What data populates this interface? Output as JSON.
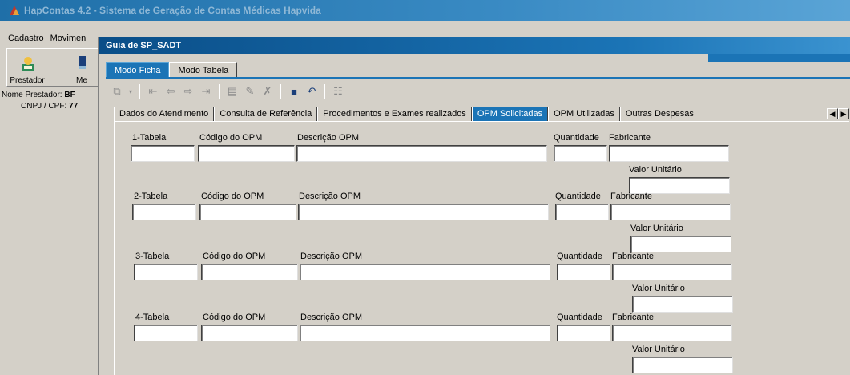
{
  "window": {
    "title": "HapContas 4.2 - Sistema de Geração de Contas Médicas Hapvida"
  },
  "menu": {
    "items": [
      "Cadastro",
      "Movimen"
    ]
  },
  "toolbar": {
    "btn1": "Prestador",
    "btn2": "Me"
  },
  "info": {
    "nome_label": "Nome Prestador:",
    "nome_value": "BF",
    "cnpj_label": "CNPJ / CPF:",
    "cnpj_value": "77"
  },
  "child": {
    "title": "Guia de SP_SADT",
    "mode_tabs": [
      "Modo Ficha",
      "Modo Tabela"
    ],
    "tabs": [
      "Dados do Atendimento",
      "Consulta de Referência",
      "Procedimentos e Exames realizados",
      "OPM Solicitadas",
      "OPM Utilizadas",
      "Outras Despesas"
    ],
    "active_tab": "OPM Solicitadas"
  },
  "form": {
    "rows": [
      {
        "tabela": "1-Tabela",
        "codigo": "Código do OPM",
        "descricao": "Descrição OPM",
        "quantidade": "Quantidade",
        "fabricante": "Fabricante",
        "valor": "Valor Unitário"
      },
      {
        "tabela": "2-Tabela",
        "codigo": "Código do OPM",
        "descricao": "Descrição OPM",
        "quantidade": "Quantidade",
        "fabricante": "Fabricante",
        "valor": "Valor Unitário"
      },
      {
        "tabela": "3-Tabela",
        "codigo": "Código do OPM",
        "descricao": "Descrição OPM",
        "quantidade": "Quantidade",
        "fabricante": "Fabricante",
        "valor": "Valor Unitário"
      },
      {
        "tabela": "4-Tabela",
        "codigo": "Código do OPM",
        "descricao": "Descrição OPM",
        "quantidade": "Quantidade",
        "fabricante": "Fabricante",
        "valor": "Valor Unitário"
      }
    ]
  },
  "icons": {
    "app": "hapvida-icon",
    "prestador": "prestador-icon",
    "nav_first": "first-record-icon",
    "nav_prev": "prev-record-icon",
    "nav_next": "next-record-icon",
    "nav_last": "last-record-icon",
    "save": "save-icon",
    "undo": "undo-icon"
  },
  "colors": {
    "title_bar": "#1b74b6",
    "active_tab": "#1b74b6",
    "face": "#d4d0c8"
  }
}
